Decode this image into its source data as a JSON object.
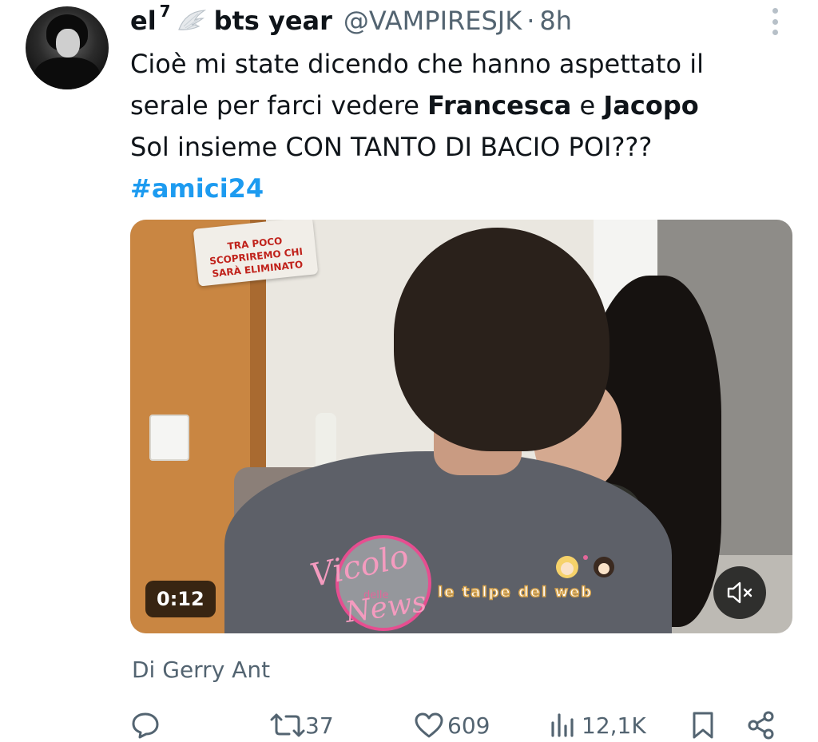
{
  "author": {
    "display_name": "el",
    "superscript": "7",
    "name_suffix": "bts year",
    "handle": "@VAMPIRESJK",
    "separator": "·",
    "time": "8h"
  },
  "tweet": {
    "line1": "Cioè mi state dicendo che hanno aspettato il",
    "line2_pre": "serale per farci vedere ",
    "line2_bold1": "Francesca",
    "line2_mid": " e ",
    "line2_bold2": "Jacopo",
    "line3": "Sol insieme CON TANTO DI BACIO POI???",
    "hashtag": "#amici24"
  },
  "media": {
    "duration": "0:12",
    "sign_text": "TRA POCO SCOPRIREMO CHI SARÀ ELIMINATO",
    "mute_icon": "speaker-muted-icon"
  },
  "watermarks": {
    "vicolo": "Vicolo",
    "delle": "delle",
    "news": "News",
    "talpe": "le talpe del web"
  },
  "source": "Di Gerry Ant",
  "actions": {
    "reply_icon": "reply-icon",
    "retweet_icon": "retweet-icon",
    "retweet_count": "37",
    "like_icon": "heart-icon",
    "like_count": "609",
    "views_icon": "views-icon",
    "views_count": "12,1K",
    "bookmark_icon": "bookmark-icon",
    "share_icon": "share-icon"
  },
  "colors": {
    "text": "#0f1419",
    "secondary": "#536471",
    "link": "#1d9bf0"
  }
}
